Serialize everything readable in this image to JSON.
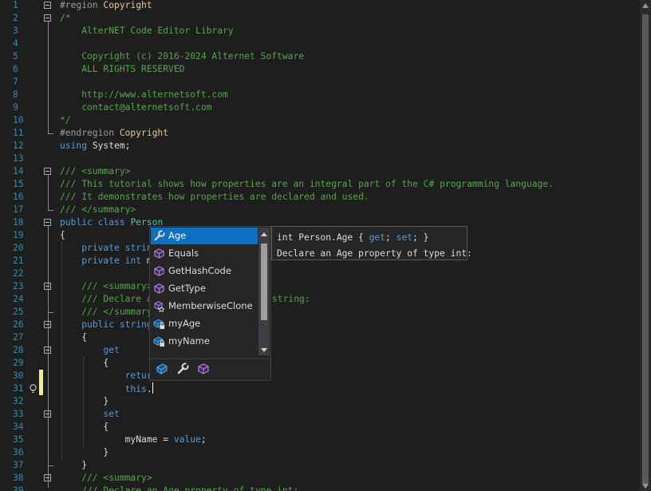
{
  "editor": {
    "lines": [
      {
        "n": "1",
        "t": "#region Copyright"
      },
      {
        "n": "2",
        "t": "/*"
      },
      {
        "n": "3",
        "t": "    AlterNET Code Editor Library"
      },
      {
        "n": "4",
        "t": ""
      },
      {
        "n": "5",
        "t": "    Copyright (c) 2016-2024 Alternet Software"
      },
      {
        "n": "6",
        "t": "    ALL RIGHTS RESERVED"
      },
      {
        "n": "7",
        "t": ""
      },
      {
        "n": "8",
        "t": "    http://www.alternetsoft.com"
      },
      {
        "n": "9",
        "t": "    contact@alternetsoft.com"
      },
      {
        "n": "10",
        "t": "*/"
      },
      {
        "n": "11",
        "t": "#endregion Copyright"
      },
      {
        "n": "12",
        "t": "using System;"
      },
      {
        "n": "13",
        "t": ""
      },
      {
        "n": "14",
        "t": "/// <summary>"
      },
      {
        "n": "15",
        "t": "/// This tutorial shows how properties are an integral part of the C# programming language."
      },
      {
        "n": "16",
        "t": "/// It demonstrates how properties are declared and used."
      },
      {
        "n": "17",
        "t": "/// </summary>"
      },
      {
        "n": "18",
        "t": "public class Person"
      },
      {
        "n": "19",
        "t": "{"
      },
      {
        "n": "20",
        "t": "    private strin"
      },
      {
        "n": "21",
        "t": "    private int m"
      },
      {
        "n": "22",
        "t": ""
      },
      {
        "n": "23",
        "t": "    /// <summary>"
      },
      {
        "n": "24",
        "t": "    /// Declare a"
      },
      {
        "n": "25",
        "t": "    /// </summary"
      },
      {
        "n": "26",
        "t": "    public string"
      },
      {
        "n": "27",
        "t": "    {"
      },
      {
        "n": "28",
        "t": "        get"
      },
      {
        "n": "29",
        "t": "        {"
      },
      {
        "n": "30",
        "t": "            retur"
      },
      {
        "n": "31",
        "t": "            this."
      },
      {
        "n": "32",
        "t": "        }"
      },
      {
        "n": "33",
        "t": "        set"
      },
      {
        "n": "34",
        "t": "        {"
      },
      {
        "n": "35",
        "t": "            myName = value;"
      },
      {
        "n": "36",
        "t": "        }"
      },
      {
        "n": "37",
        "t": "    }"
      },
      {
        "n": "38",
        "t": "    /// <summary>"
      },
      {
        "n": "39",
        "t": "    /// Declare an Age property of type int:"
      }
    ],
    "line24_tail": "string:"
  },
  "completion": {
    "items": [
      {
        "label": "Age",
        "icon": "wrench-icon",
        "selected": true
      },
      {
        "label": "Equals",
        "icon": "method-cube-icon"
      },
      {
        "label": "GetHashCode",
        "icon": "method-cube-icon"
      },
      {
        "label": "GetType",
        "icon": "method-cube-icon"
      },
      {
        "label": "MemberwiseClone",
        "icon": "method-protected-icon"
      },
      {
        "label": "myAge",
        "icon": "field-private-icon"
      },
      {
        "label": "myName",
        "icon": "field-private-icon"
      }
    ],
    "filters": [
      "field-filter-icon",
      "property-filter-icon",
      "method-filter-icon"
    ]
  },
  "tooltip": {
    "signature_pre": "int Person.Age { ",
    "get_kw": "get",
    "mid": "; ",
    "set_kw": "set",
    "signature_post": "; }",
    "description": "Declare an Age property of type int:"
  },
  "colors": {
    "background": "#1e1e1e",
    "line_number": "#2b91af",
    "comment": "#57a64a",
    "keyword": "#569cd6",
    "type": "#4ec9b0",
    "selection": "#0e70c0"
  }
}
